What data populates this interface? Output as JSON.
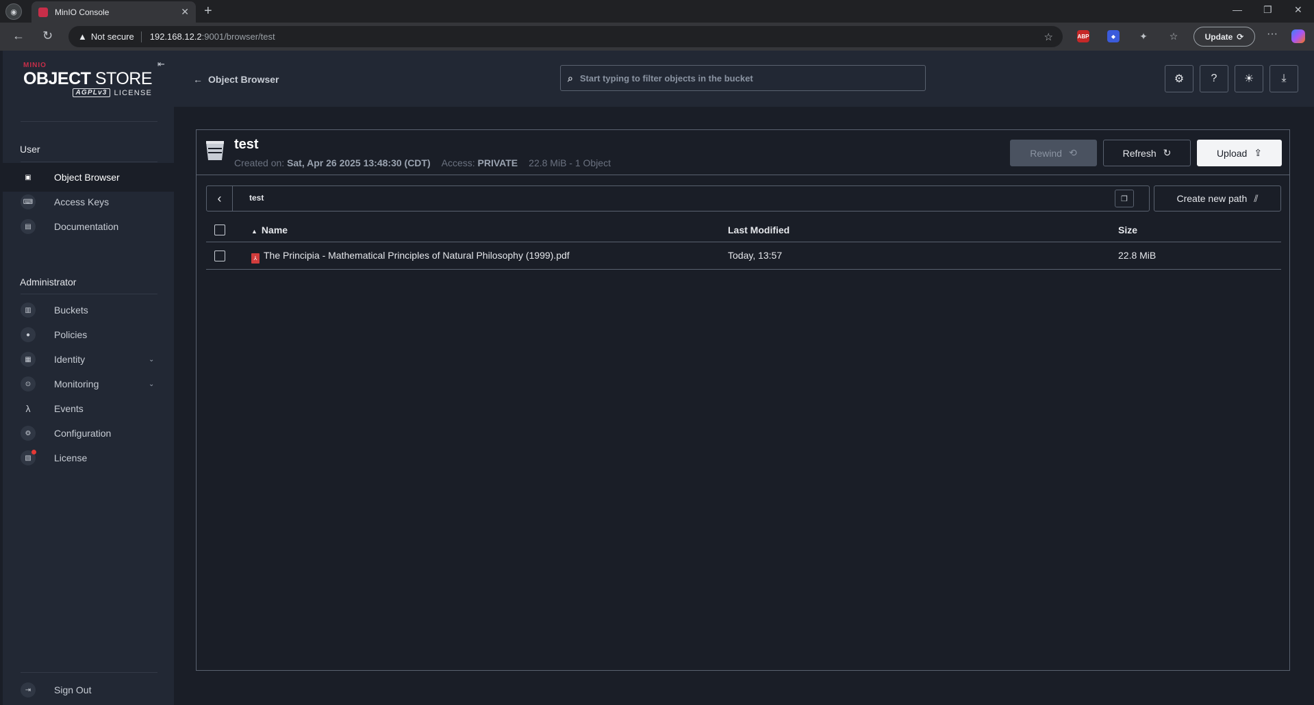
{
  "browser": {
    "tab_title": "MinIO Console",
    "security_label": "Not secure",
    "url_host": "192.168.12.2",
    "url_path": ":9001/browser/test",
    "update_label": "Update",
    "ext_abp": "ABP"
  },
  "sidebar": {
    "logo": {
      "brand": "MINIO",
      "product_bold": "OBJECT",
      "product_light": " STORE",
      "license_badge": "AGPLv3",
      "license_label": "LICENSE"
    },
    "sections": [
      {
        "title": "User",
        "items": [
          {
            "label": "Object Browser",
            "icon": "object-browser-icon",
            "active": true
          },
          {
            "label": "Access Keys",
            "icon": "access-keys-icon"
          },
          {
            "label": "Documentation",
            "icon": "documentation-icon"
          }
        ]
      },
      {
        "title": "Administrator",
        "items": [
          {
            "label": "Buckets",
            "icon": "buckets-icon"
          },
          {
            "label": "Policies",
            "icon": "policies-icon"
          },
          {
            "label": "Identity",
            "icon": "identity-icon",
            "expandable": true
          },
          {
            "label": "Monitoring",
            "icon": "monitoring-icon",
            "expandable": true
          },
          {
            "label": "Events",
            "icon": "lambda-icon"
          },
          {
            "label": "Configuration",
            "icon": "gear-icon"
          },
          {
            "label": "License",
            "icon": "license-icon",
            "badge": true
          }
        ]
      }
    ],
    "sign_out": "Sign Out"
  },
  "header": {
    "back_label": "Object Browser",
    "filter_placeholder": "Start typing to filter objects in the bucket"
  },
  "bucket": {
    "name": "test",
    "created_label": "Created on:",
    "created_value": "Sat, Apr 26 2025 13:48:30 (CDT)",
    "access_label": "Access:",
    "access_value": "PRIVATE",
    "usage": "22.8 MiB - 1 Object",
    "buttons": {
      "rewind": "Rewind",
      "refresh": "Refresh",
      "upload": "Upload"
    }
  },
  "path": {
    "current": "test",
    "create_new_path": "Create new path"
  },
  "table": {
    "columns": [
      "Name",
      "Last Modified",
      "Size"
    ],
    "rows": [
      {
        "name": "The Principia - Mathematical Principles of Natural Philosophy (1999).pdf",
        "modified": "Today, 13:57",
        "size": "22.8 MiB"
      }
    ]
  },
  "colors": {
    "accent": "#c72e49",
    "background": "#1a1e27",
    "sidebar": "#222834"
  }
}
